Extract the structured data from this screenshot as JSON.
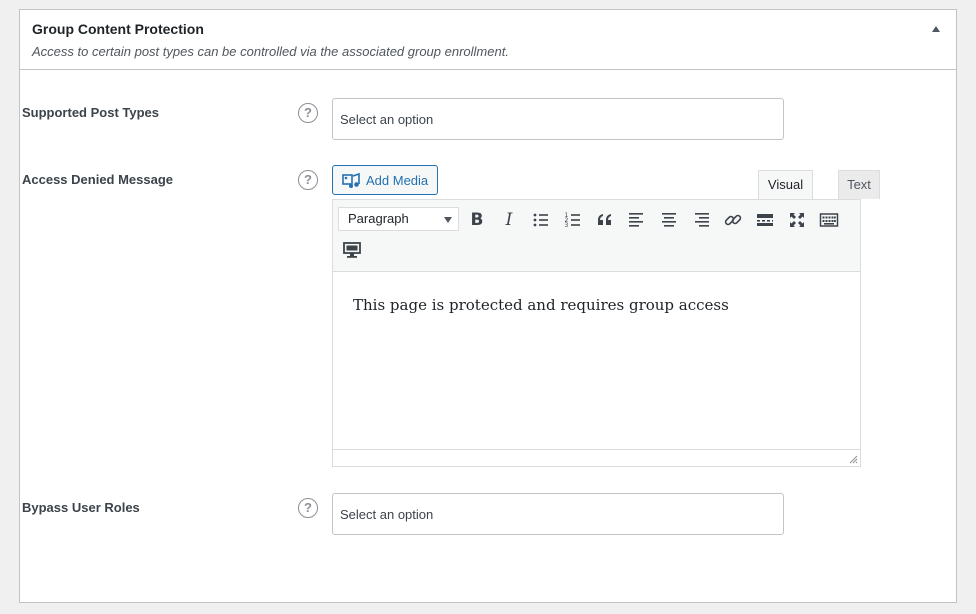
{
  "metabox": {
    "title": "Group Content Protection",
    "description": "Access to certain post types can be controlled via the associated group enrollment.",
    "toggle_icon": "arrow-up-icon"
  },
  "fields": {
    "supported_post_types": {
      "label": "Supported Post Types",
      "placeholder": "Select an option",
      "help_icon": "help-icon"
    },
    "access_denied_message": {
      "label": "Access Denied Message",
      "help_icon": "help-icon"
    },
    "bypass_user_roles": {
      "label": "Bypass User Roles",
      "placeholder": "Select an option",
      "help_icon": "help-icon"
    }
  },
  "editor": {
    "add_media_label": "Add Media",
    "tabs": {
      "visual": "Visual",
      "text": "Text"
    },
    "active_tab": "Visual",
    "format": "Paragraph",
    "toolbar_buttons": [
      "bold",
      "italic",
      "bulleted-list",
      "numbered-list",
      "blockquote",
      "align-left",
      "align-center",
      "align-right",
      "insert-link",
      "read-more",
      "fullscreen",
      "toolbar-toggle",
      "screen-icon"
    ],
    "content": "This page is protected and requires group access"
  },
  "colors": {
    "accent": "#2271b1",
    "border": "#c3c4c7",
    "background": "#f0f0f1"
  }
}
